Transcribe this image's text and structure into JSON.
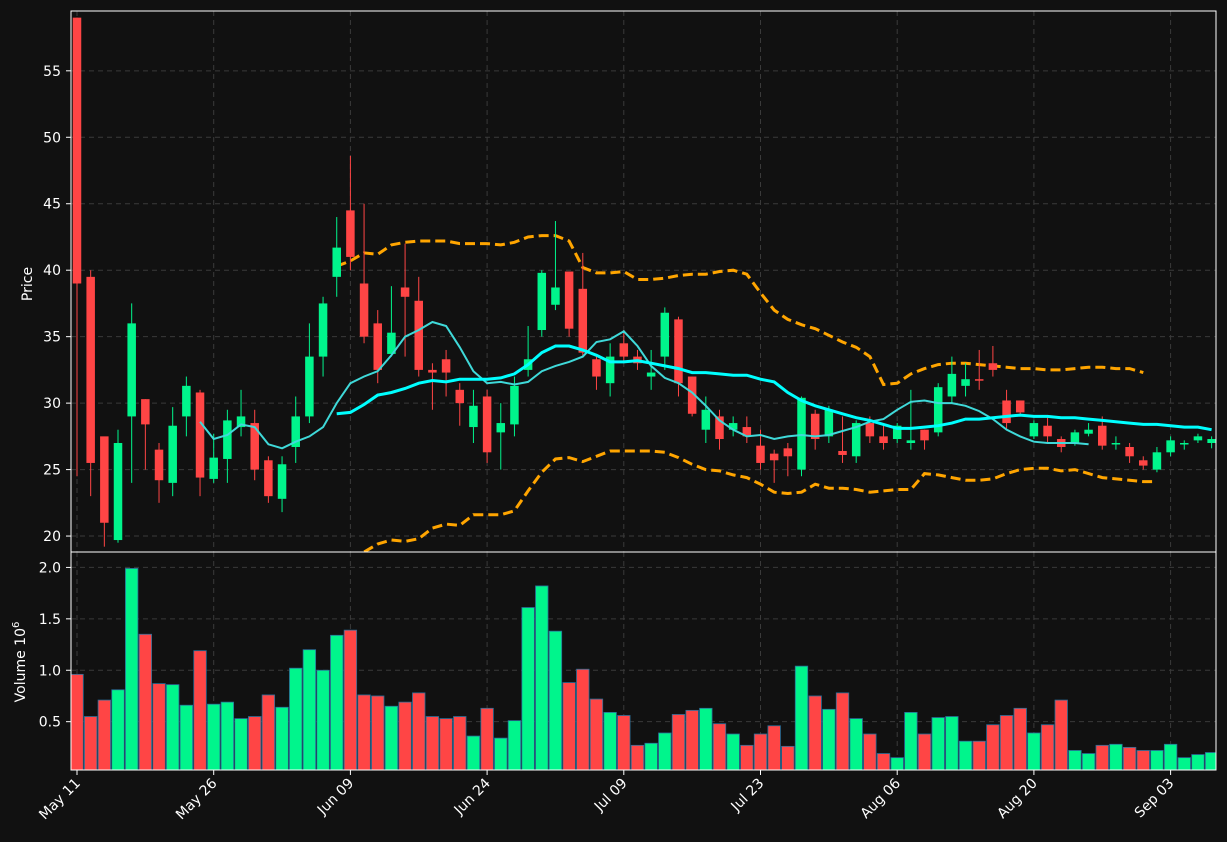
{
  "chart_data": {
    "type": "candlestick",
    "price_ylabel": "Price",
    "volume_ylabel": "Volume  10",
    "volume_exponent": "6",
    "xtick_labels": [
      "May 11",
      "May 26",
      "Jun 09",
      "Jun 24",
      "Jul 09",
      "Jul 23",
      "Aug 06",
      "Aug 20",
      "Sep 03"
    ],
    "price_ticks": [
      20,
      25,
      30,
      35,
      40,
      45,
      50,
      55
    ],
    "price_ylim": [
      18.8,
      59.5
    ],
    "volume_ticks": [
      0.5,
      1.0,
      1.5,
      2.0
    ],
    "volume_tick_labels": [
      "0.5",
      "1.0",
      "1.5",
      "2.0"
    ],
    "volume_ylim": [
      0.03,
      2.15
    ],
    "grid": true,
    "colors": {
      "background": "#111111",
      "up": "#00f58c",
      "down": "#ff4545",
      "volume_edge": "#2a6f9a",
      "sma_short": "#3fd9d9",
      "sma_long": "#00ffff",
      "bands": "#ffa500",
      "frame": "#ffffff"
    },
    "candles": [
      [
        59,
        39,
        59,
        24.5,
        0.96
      ],
      [
        39.5,
        25.5,
        40,
        23,
        0.55
      ],
      [
        27.5,
        21,
        27.3,
        19.2,
        0.71
      ],
      [
        19.7,
        27,
        28,
        19.5,
        0.81
      ],
      [
        29,
        36,
        37.5,
        24,
        1.99
      ],
      [
        30.3,
        28.4,
        30.3,
        25,
        1.35
      ],
      [
        26.5,
        24.2,
        27,
        22.5,
        0.87
      ],
      [
        24,
        28.3,
        29.7,
        23,
        0.86
      ],
      [
        29,
        31.3,
        32,
        27.5,
        0.66
      ],
      [
        30.8,
        24.4,
        31,
        23,
        1.19
      ],
      [
        24.3,
        25.9,
        27.7,
        24,
        0.67
      ],
      [
        25.8,
        28.7,
        29.5,
        24,
        0.69
      ],
      [
        28.2,
        29,
        31,
        27.5,
        0.53
      ],
      [
        28.5,
        25,
        29.5,
        24.2,
        0.55
      ],
      [
        25.7,
        23,
        26,
        22.5,
        0.76
      ],
      [
        22.8,
        25.4,
        26,
        21.8,
        0.64
      ],
      [
        26.7,
        29,
        30.5,
        25.5,
        1.02
      ],
      [
        29,
        33.5,
        36,
        28.5,
        1.2
      ],
      [
        33.5,
        37.5,
        38,
        32,
        1.0
      ],
      [
        39.5,
        41.7,
        44,
        38,
        1.34
      ],
      [
        44.5,
        41,
        48.6,
        40,
        1.39
      ],
      [
        39,
        35,
        45,
        34.5,
        0.76
      ],
      [
        36,
        32.5,
        37,
        31.5,
        0.75
      ],
      [
        33.7,
        35.3,
        38.8,
        33.5,
        0.65
      ],
      [
        38.7,
        38,
        42,
        33.5,
        0.69
      ],
      [
        37.7,
        32.5,
        39.5,
        32,
        0.78
      ],
      [
        32.5,
        32.3,
        33,
        29.5,
        0.55
      ],
      [
        33.3,
        32.3,
        34,
        30.5,
        0.53
      ],
      [
        31,
        30,
        31.5,
        28.3,
        0.55
      ],
      [
        28.2,
        29.8,
        31,
        27,
        0.36
      ],
      [
        30.5,
        26.3,
        31,
        25.5,
        0.63
      ],
      [
        27.8,
        28.5,
        30,
        25,
        0.34
      ],
      [
        28.4,
        31.3,
        32,
        27.5,
        0.51
      ],
      [
        32.5,
        33.3,
        35.8,
        32,
        1.61
      ],
      [
        35.5,
        39.8,
        40,
        35,
        1.82
      ],
      [
        37.4,
        38.7,
        43.7,
        37,
        1.38
      ],
      [
        39.9,
        35.6,
        39.9,
        35,
        0.88
      ],
      [
        38.6,
        33.8,
        41.3,
        33.5,
        1.01
      ],
      [
        33.3,
        32,
        33.5,
        31,
        0.72
      ],
      [
        31.5,
        33.5,
        34.5,
        30.5,
        0.59
      ],
      [
        34.5,
        33.5,
        35.5,
        33,
        0.56
      ],
      [
        33.5,
        33,
        34,
        32.5,
        0.27
      ],
      [
        32,
        32.3,
        34,
        31,
        0.29
      ],
      [
        33.5,
        36.8,
        37.2,
        32.5,
        0.39
      ],
      [
        36.3,
        31.5,
        36.5,
        30.5,
        0.57
      ],
      [
        32,
        29.2,
        32,
        29,
        0.61
      ],
      [
        28,
        29.5,
        30.5,
        27,
        0.63
      ],
      [
        29,
        27.3,
        29.5,
        26.5,
        0.48
      ],
      [
        28,
        28.5,
        29,
        27.5,
        0.38
      ],
      [
        28.2,
        27.5,
        29,
        27,
        0.27
      ],
      [
        26.8,
        25.5,
        28,
        25,
        0.38
      ],
      [
        26.2,
        25.7,
        26.5,
        24,
        0.46
      ],
      [
        26.6,
        26,
        27,
        24.5,
        0.26
      ],
      [
        25,
        30.4,
        30.5,
        24.5,
        1.04
      ],
      [
        29.2,
        27.3,
        29.5,
        26.5,
        0.75
      ],
      [
        27.5,
        29.5,
        29.8,
        27,
        0.62
      ],
      [
        26.4,
        26.1,
        29,
        25.5,
        0.78
      ],
      [
        26,
        28.5,
        28.7,
        25.5,
        0.53
      ],
      [
        28.5,
        27.5,
        29,
        27,
        0.38
      ],
      [
        27.5,
        27,
        28.5,
        26.5,
        0.19
      ],
      [
        27.3,
        28.3,
        28.5,
        27,
        0.15
      ],
      [
        27,
        27.2,
        31,
        26.5,
        0.59
      ],
      [
        28,
        27.2,
        28,
        26.5,
        0.38
      ],
      [
        27.8,
        31.2,
        31.5,
        27.5,
        0.54
      ],
      [
        30.5,
        32.2,
        33.5,
        30,
        0.55
      ],
      [
        31.3,
        31.8,
        33,
        30.5,
        0.31
      ],
      [
        31.8,
        31.7,
        34,
        31,
        0.31
      ],
      [
        33,
        32.5,
        34.3,
        32,
        0.47
      ],
      [
        30.2,
        28.5,
        31,
        28,
        0.56
      ],
      [
        30.2,
        29.3,
        30.2,
        29,
        0.63
      ],
      [
        27.5,
        28.5,
        28.7,
        27.3,
        0.39
      ],
      [
        28.3,
        27.5,
        29,
        27,
        0.47
      ],
      [
        27.3,
        26.7,
        27.5,
        26.3,
        0.71
      ],
      [
        27,
        27.8,
        28,
        26.8,
        0.22
      ],
      [
        27.7,
        28,
        28.5,
        27.5,
        0.19
      ],
      [
        28.3,
        26.8,
        29,
        26.5,
        0.27
      ],
      [
        27,
        27,
        27.5,
        26.5,
        0.28
      ],
      [
        26.7,
        26,
        27,
        25.5,
        0.25
      ],
      [
        25.7,
        25.3,
        26,
        25,
        0.22
      ],
      [
        25,
        26.3,
        26.7,
        24.8,
        0.22
      ],
      [
        26.3,
        27.2,
        27.5,
        26,
        0.28
      ],
      [
        27,
        27,
        27.2,
        26.5,
        0.15
      ],
      [
        27.2,
        27.5,
        27.7,
        27,
        0.18
      ],
      [
        27,
        27.3,
        27.5,
        26.6,
        0.2
      ]
    ],
    "sma_short": {
      "start_index": 9,
      "values": [
        28.6,
        27.3,
        27.6,
        28.4,
        28.2,
        26.9,
        26.6,
        27.1,
        27.5,
        28.2,
        30,
        31.5,
        32,
        32.4,
        33.6,
        35,
        35.5,
        36.1,
        35.8,
        34.2,
        32.4,
        31.5,
        31.6,
        31.4,
        31.6,
        32.4,
        32.8,
        33.1,
        33.5,
        34.6,
        34.8,
        35.4,
        34.3,
        32.8,
        31.9,
        31.5,
        30.8,
        29.8,
        28.7,
        28,
        27.5,
        27.6,
        27.3,
        27.5,
        27.6,
        27.5,
        27.6,
        27.9,
        28.2,
        28.6,
        28.8,
        29.5,
        30.1,
        30.2,
        30,
        30,
        29.8,
        29.4,
        28.8,
        28,
        27.5,
        27.1,
        27,
        27,
        27,
        26.9
      ]
    },
    "sma_long": {
      "start_index": 19,
      "values": [
        29.2,
        29.3,
        29.9,
        30.6,
        30.8,
        31.1,
        31.5,
        31.7,
        31.6,
        31.8,
        31.8,
        31.8,
        31.9,
        32.2,
        32.9,
        33.8,
        34.3,
        34.3,
        34,
        33.6,
        33.1,
        33.1,
        33.2,
        33,
        32.8,
        32.6,
        32.3,
        32.3,
        32.2,
        32.1,
        32.1,
        31.8,
        31.6,
        30.8,
        30.2,
        29.8,
        29.5,
        29.2,
        28.9,
        28.7,
        28.4,
        28.1,
        28.1,
        28.2,
        28.3,
        28.5,
        28.8,
        28.8,
        28.9,
        29,
        29.1,
        29,
        29,
        28.9,
        28.9,
        28.8,
        28.7,
        28.6,
        28.5,
        28.4,
        28.4,
        28.3,
        28.2,
        28.2,
        28
      ]
    },
    "bollinger_upper": {
      "start_index": 19,
      "values": [
        40.3,
        40.7,
        41.3,
        41.2,
        41.9,
        42.1,
        42.2,
        42.2,
        42.2,
        42,
        42,
        42,
        41.9,
        42.1,
        42.5,
        42.6,
        42.6,
        42.2,
        40.2,
        39.8,
        39.8,
        39.9,
        39.3,
        39.3,
        39.4,
        39.6,
        39.7,
        39.7,
        39.9,
        40,
        39.7,
        38.3,
        37,
        36.3,
        35.9,
        35.6,
        35.1,
        34.6,
        34.2,
        33.5,
        31.4,
        31.5,
        32.2,
        32.6,
        32.9,
        33,
        33,
        32.9,
        32.8,
        32.7,
        32.6,
        32.6,
        32.5,
        32.5,
        32.6,
        32.7,
        32.7,
        32.6,
        32.6,
        32.3
      ]
    },
    "bollinger_lower": {
      "start_index": 19,
      "values": [
        18,
        18.2,
        18.8,
        19.4,
        19.7,
        19.6,
        19.8,
        20.6,
        20.9,
        20.8,
        21.6,
        21.6,
        21.6,
        21.9,
        23.4,
        24.8,
        25.8,
        25.9,
        25.6,
        26,
        26.4,
        26.4,
        26.4,
        26.4,
        26.3,
        25.9,
        25.4,
        25,
        24.9,
        24.6,
        24.4,
        23.9,
        23.3,
        23.2,
        23.3,
        23.9,
        23.6,
        23.6,
        23.5,
        23.3,
        23.4,
        23.5,
        23.5,
        24.7,
        24.6,
        24.4,
        24.2,
        24.2,
        24.3,
        24.7,
        25,
        25.1,
        25.1,
        24.9,
        25,
        24.7,
        24.4,
        24.3,
        24.2,
        24.1,
        24.1
      ]
    }
  }
}
